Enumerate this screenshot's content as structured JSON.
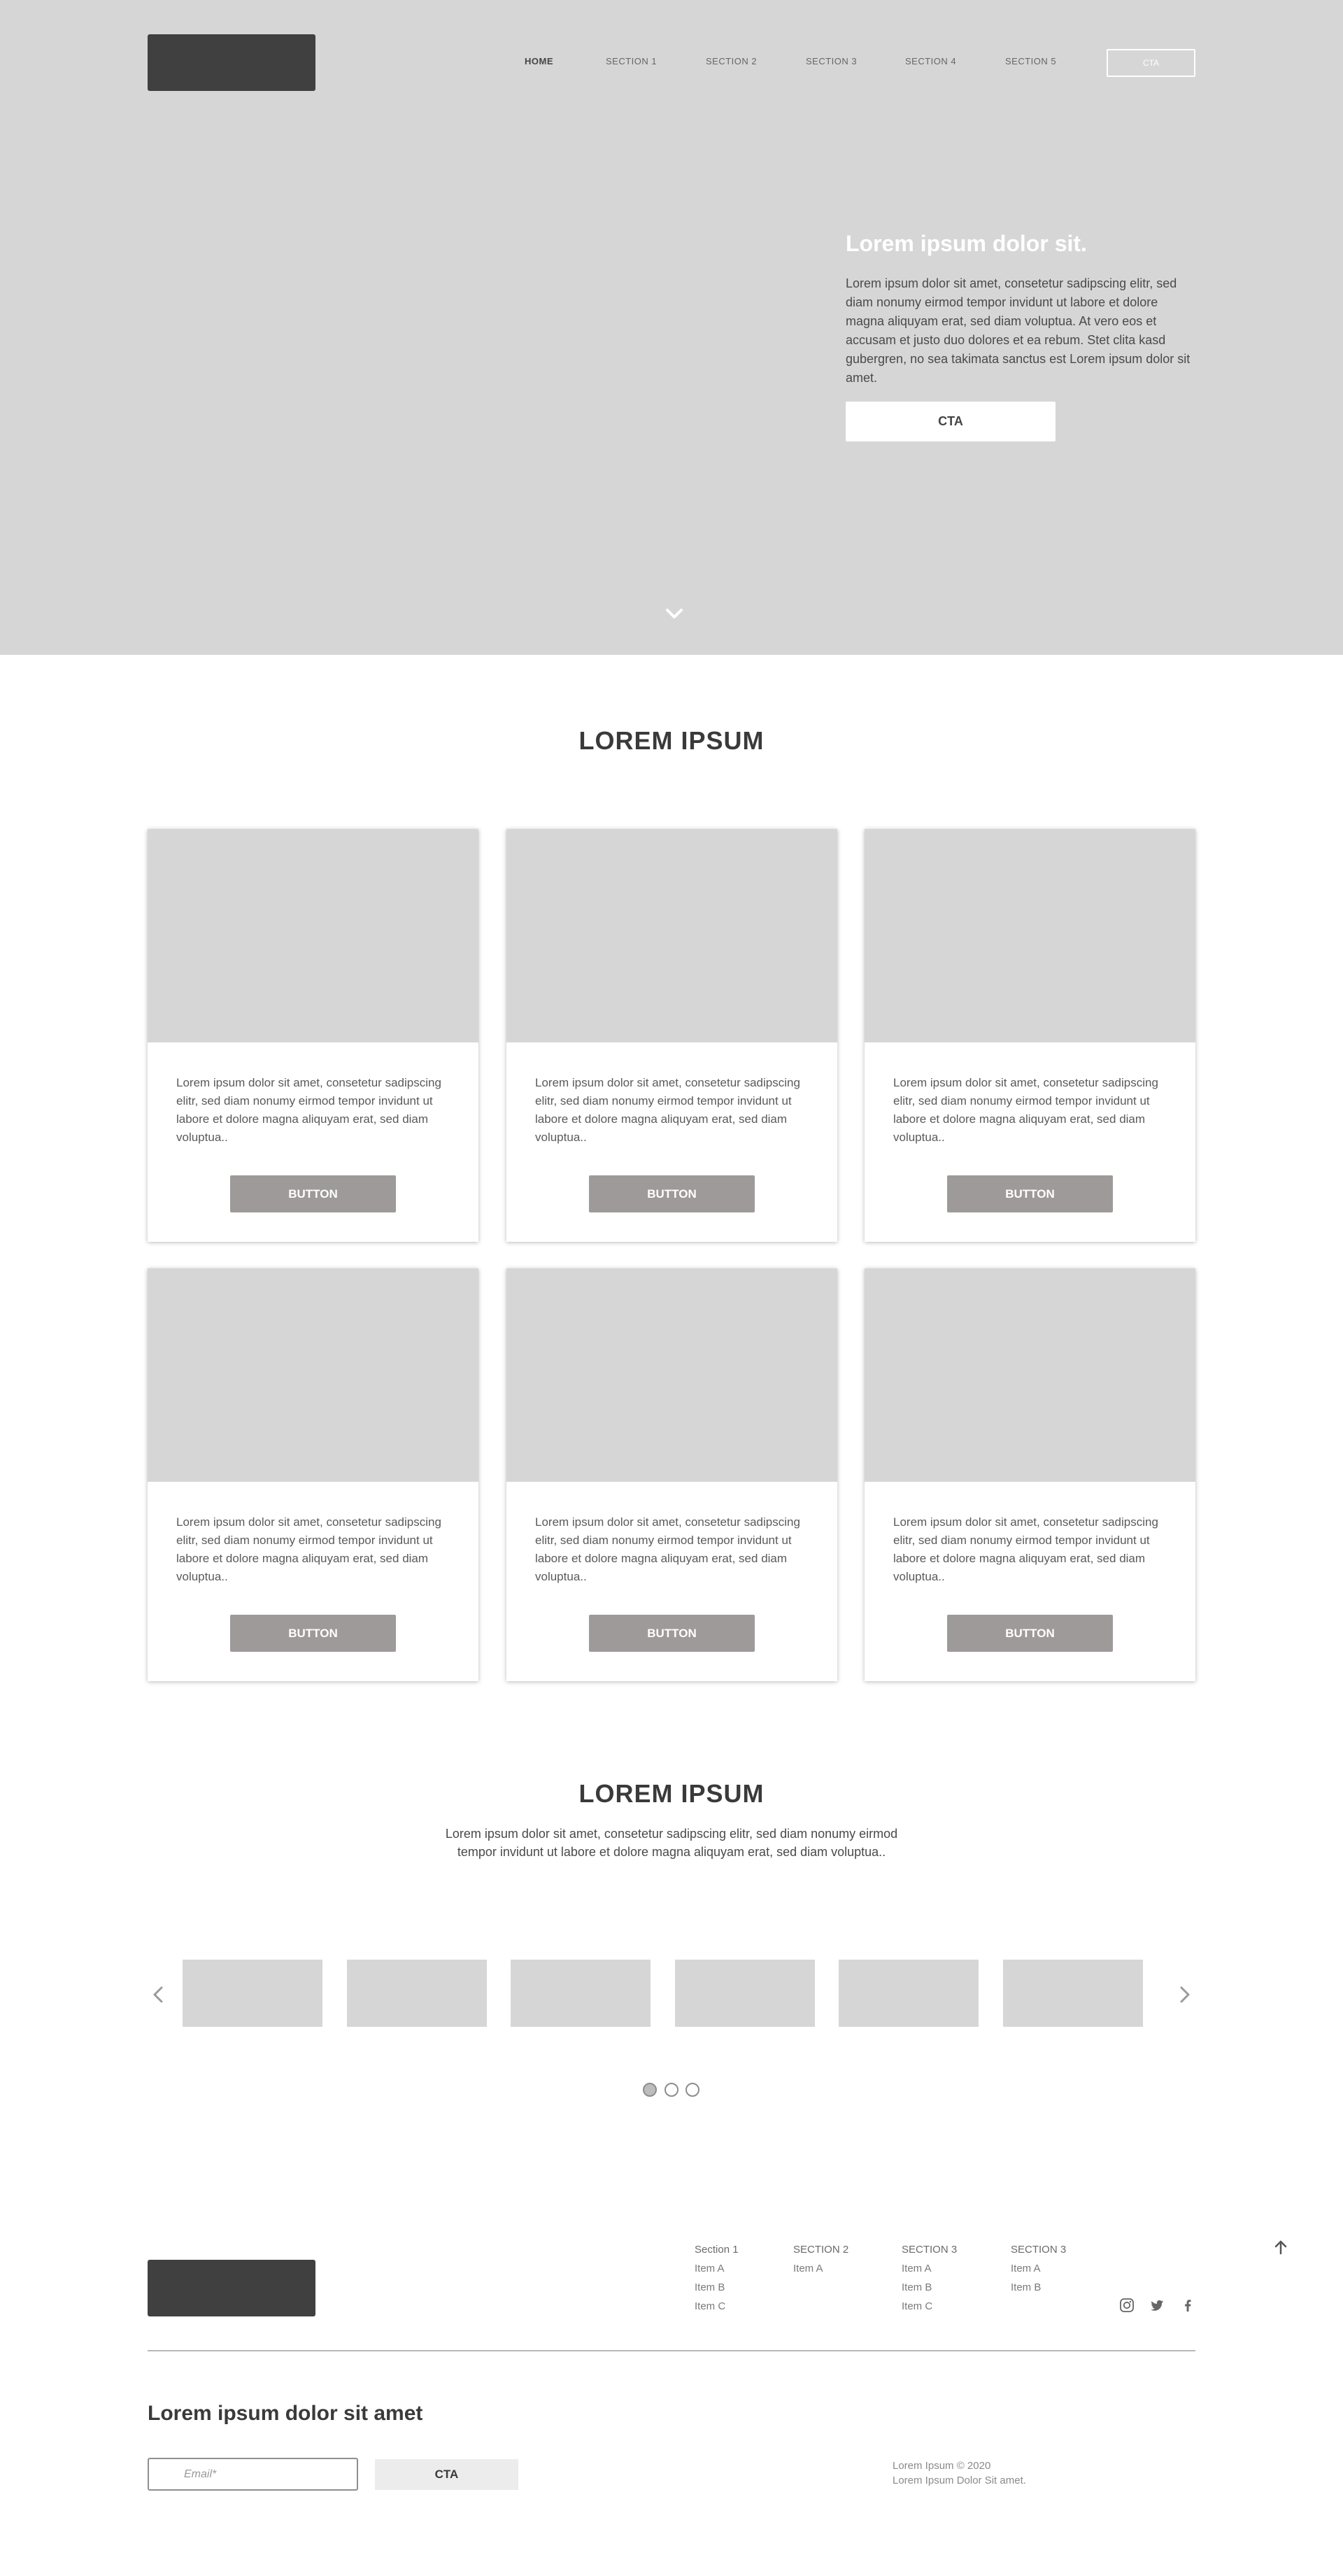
{
  "header": {
    "nav": [
      {
        "label": "HOME"
      },
      {
        "label": "SECTION 1"
      },
      {
        "label": "SECTION 2"
      },
      {
        "label": "SECTION 3"
      },
      {
        "label": "SECTION 4"
      },
      {
        "label": "SECTION 5"
      }
    ],
    "cta_label": "CTA"
  },
  "hero": {
    "title": "Lorem ipsum dolor sit.",
    "text": "Lorem ipsum dolor sit amet, consetetur sadipscing elitr, sed diam nonumy eirmod tempor invidunt ut labore et dolore magna aliquyam erat, sed diam voluptua. At vero eos et accusam et justo duo dolores et ea rebum. Stet clita kasd gubergren, no sea takimata sanctus est Lorem ipsum dolor sit amet.",
    "cta_label": "CTA",
    "scroll_icon": "chevron-down-icon"
  },
  "cards_section": {
    "title": "LOREM IPSUM",
    "cards": [
      {
        "text": "Lorem ipsum dolor sit amet, consetetur sadipscing elitr, sed diam nonumy eirmod tempor invidunt ut labore et dolore magna aliquyam erat, sed diam voluptua..",
        "button": "BUTTON"
      },
      {
        "text": "Lorem ipsum dolor sit amet, consetetur sadipscing elitr, sed diam nonumy eirmod tempor invidunt ut labore et dolore magna aliquyam erat, sed diam voluptua..",
        "button": "BUTTON"
      },
      {
        "text": "Lorem ipsum dolor sit amet, consetetur sadipscing elitr, sed diam nonumy eirmod tempor invidunt ut labore et dolore magna aliquyam erat, sed diam voluptua..",
        "button": "BUTTON"
      },
      {
        "text": "Lorem ipsum dolor sit amet, consetetur sadipscing elitr, sed diam nonumy eirmod tempor invidunt ut labore et dolore magna aliquyam erat, sed diam voluptua..",
        "button": "BUTTON"
      },
      {
        "text": "Lorem ipsum dolor sit amet, consetetur sadipscing elitr, sed diam nonumy eirmod tempor invidunt ut labore et dolore magna aliquyam erat, sed diam voluptua..",
        "button": "BUTTON"
      },
      {
        "text": "Lorem ipsum dolor sit amet, consetetur sadipscing elitr, sed diam nonumy eirmod tempor invidunt ut labore et dolore magna aliquyam erat, sed diam voluptua..",
        "button": "BUTTON"
      }
    ]
  },
  "carousel_section": {
    "title": "LOREM IPSUM",
    "text_line1": "Lorem ipsum dolor sit amet, consetetur sadipscing elitr, sed diam nonumy eirmod",
    "text_line2": "tempor invidunt ut labore et dolore magna aliquyam erat, sed diam voluptua..",
    "prev_icon": "chevron-left-icon",
    "next_icon": "chevron-right-icon",
    "item_count": 6,
    "page_count": 3,
    "active_page": 1
  },
  "footer": {
    "columns": [
      {
        "heading": "Section 1",
        "items": [
          "Item A",
          "Item B",
          "Item C"
        ]
      },
      {
        "heading": "SECTION 2",
        "items": [
          "Item A"
        ]
      },
      {
        "heading": "SECTION 3",
        "items": [
          "Item A",
          "Item B",
          "Item C"
        ]
      },
      {
        "heading": "SECTION 3",
        "items": [
          "Item A",
          "Item B"
        ]
      }
    ],
    "back_to_top_icon": "arrow-up-icon",
    "social_icons": [
      "instagram-icon",
      "twitter-icon",
      "facebook-icon"
    ],
    "newsletter_title": "Lorem ipsum dolor sit amet",
    "email_placeholder": "Email*",
    "cta_label": "CTA",
    "copyright_line1": "Lorem Ipsum © 2020",
    "copyright_line2": "Lorem Ipsum Dolor Sit amet."
  }
}
